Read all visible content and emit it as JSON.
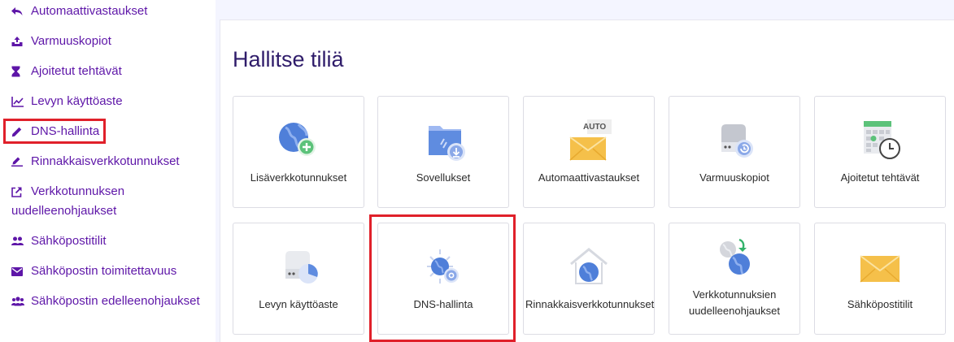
{
  "sidebar": {
    "items": [
      {
        "label": "Automaattivastaukset",
        "icon": "reply-icon"
      },
      {
        "label": "Varmuuskopiot",
        "icon": "backup-tray-icon"
      },
      {
        "label": "Ajoitetut tehtävät",
        "icon": "hourglass-icon"
      },
      {
        "label": "Levyn käyttöaste",
        "icon": "chart-line-icon"
      },
      {
        "label": "DNS-hallinta",
        "icon": "pencil-icon",
        "active": true
      },
      {
        "label": "Rinnakkaisverkkotunnukset",
        "icon": "edit-line-icon"
      },
      {
        "label": "Verkkotunnuksen uudelleenohjaukset",
        "icon": "external-link-icon"
      },
      {
        "label": "Sähköpostitilit",
        "icon": "users-icon"
      },
      {
        "label": "Sähköpostin toimitettavuus",
        "icon": "envelope-icon"
      },
      {
        "label": "Sähköpostin edelleenohjaukset",
        "icon": "user-group-icon"
      }
    ]
  },
  "main": {
    "title": "Hallitse tiliä",
    "tiles": [
      {
        "label": "Lisäverkkotunnukset",
        "icon": "globe-plus-icon"
      },
      {
        "label": "Sovellukset",
        "icon": "folder-download-icon"
      },
      {
        "label": "Automaattivastaukset",
        "icon": "envelope-auto-icon",
        "badge": "AUTO"
      },
      {
        "label": "Varmuuskopiot",
        "icon": "drive-restore-icon"
      },
      {
        "label": "Ajoitetut tehtävät",
        "icon": "calendar-clock-icon"
      },
      {
        "label": "Levyn käyttöaste",
        "icon": "drive-pie-icon"
      },
      {
        "label": "DNS-hallinta",
        "icon": "globe-gear-icon",
        "highlighted": true
      },
      {
        "label": "Rinnakkaisverkkotunnukset",
        "icon": "globe-house-icon"
      },
      {
        "label": "Verkkotunnuksien uudelleenohjaukset",
        "icon": "globe-redirect-icon"
      },
      {
        "label": "Sähköpostitilit",
        "icon": "envelope-icon"
      }
    ]
  },
  "colors": {
    "accent": "#5e16a8",
    "highlight": "#e0202a",
    "title": "#2f1c6a",
    "globe": "#4f7fd9",
    "envelope": "#f5c04a"
  }
}
